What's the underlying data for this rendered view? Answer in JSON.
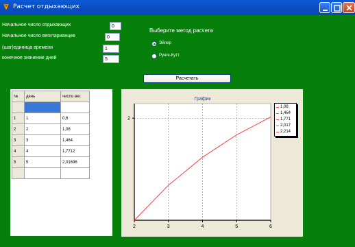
{
  "window": {
    "title": "Расчет отдыхающих",
    "colors": {
      "titlebar": "#0a55cf",
      "background": "#07800b"
    }
  },
  "params": [
    {
      "label": "Начальное число отдыхающих",
      "value": "0"
    },
    {
      "label": "Начальное число вегитарианцев",
      "value": "0"
    },
    {
      "label": "(шаг)единица времени",
      "value": "1"
    },
    {
      "label": "конечное значение дней",
      "value": "5"
    }
  ],
  "method": {
    "title": "Выберите метод расчета",
    "options": [
      {
        "label": "Эйлер",
        "selected": true
      },
      {
        "label": "Рунге-Кутт",
        "selected": false
      }
    ]
  },
  "calc_button": "Расчетать",
  "grid": {
    "headers": [
      "№",
      "день",
      "число вег."
    ],
    "rows": [
      {
        "n": "",
        "day": "",
        "value": ""
      },
      {
        "n": "1",
        "day": "1",
        "value": "0,6"
      },
      {
        "n": "2",
        "day": "2",
        "value": "1,08"
      },
      {
        "n": "3",
        "day": "3",
        "value": "1,464"
      },
      {
        "n": "4",
        "day": "4",
        "value": "1,7712"
      },
      {
        "n": "5",
        "day": "5",
        "value": "2,01696"
      },
      {
        "n": "",
        "day": "",
        "value": ""
      }
    ]
  },
  "chart_data": {
    "type": "line",
    "title": "График",
    "x": [
      2,
      3,
      4,
      5,
      6
    ],
    "series": [
      {
        "values": [
          0.6,
          1.08,
          1.464,
          1.771,
          2.017
        ],
        "color": "#ff4040"
      }
    ],
    "xlim": [
      2,
      6
    ],
    "ylim": [
      0.6,
      2.2
    ],
    "x_ticks": [
      "2",
      "3",
      "4",
      "5",
      "6"
    ],
    "y_ticks": [
      "2"
    ],
    "grid": true,
    "legend": {
      "position": "right",
      "entries": [
        "1,08",
        "1,464",
        "1,771",
        "2,017",
        "2,214"
      ]
    }
  }
}
